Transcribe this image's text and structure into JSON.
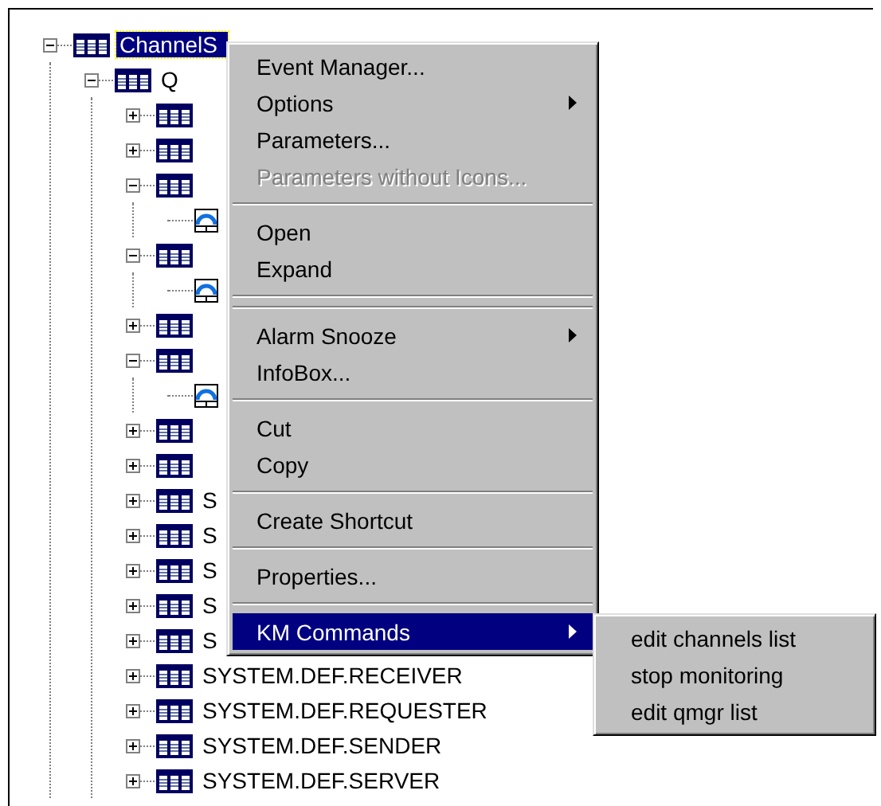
{
  "tree": {
    "kind": "table",
    "label": "ChannelS",
    "selected": true,
    "expanded": true,
    "children": [
      {
        "kind": "table",
        "label": "Q",
        "selected": false,
        "expanded": true,
        "children": [
          {
            "kind": "table",
            "expanded": false
          },
          {
            "kind": "table",
            "expanded": false
          },
          {
            "kind": "table",
            "expanded": true,
            "children": [
              {
                "kind": "monitor"
              }
            ]
          },
          {
            "kind": "table",
            "expanded": true,
            "children": [
              {
                "kind": "monitor"
              }
            ]
          },
          {
            "kind": "table",
            "expanded": false
          },
          {
            "kind": "table",
            "expanded": true,
            "children": [
              {
                "kind": "monitor"
              }
            ]
          },
          {
            "kind": "table",
            "expanded": false
          },
          {
            "kind": "table",
            "expanded": false
          },
          {
            "kind": "table",
            "label": "S",
            "expanded": false
          },
          {
            "kind": "table",
            "label": "S",
            "expanded": false
          },
          {
            "kind": "table",
            "label": "S",
            "expanded": false
          },
          {
            "kind": "table",
            "label": "S",
            "expanded": false
          },
          {
            "kind": "table",
            "label": "S",
            "expanded": false
          },
          {
            "kind": "table",
            "label": "SYSTEM.DEF.RECEIVER",
            "expanded": false
          },
          {
            "kind": "table",
            "label": "SYSTEM.DEF.REQUESTER",
            "expanded": false
          },
          {
            "kind": "table",
            "label": "SYSTEM.DEF.SENDER",
            "expanded": false
          },
          {
            "kind": "table",
            "label": "SYSTEM.DEF.SERVER",
            "expanded": false
          }
        ]
      }
    ]
  },
  "context_menu": {
    "items": [
      {
        "kind": "command",
        "label": "Event Manager...",
        "submenu": false,
        "disabled": false,
        "selected": false
      },
      {
        "kind": "command",
        "label": "Options",
        "submenu": true,
        "disabled": false,
        "selected": false
      },
      {
        "kind": "command",
        "label": "Parameters...",
        "submenu": false,
        "disabled": false,
        "selected": false
      },
      {
        "kind": "command",
        "label": "Parameters without Icons...",
        "submenu": false,
        "disabled": true,
        "selected": false
      },
      {
        "kind": "separator"
      },
      {
        "kind": "command",
        "label": "Open",
        "submenu": false,
        "disabled": false,
        "selected": false
      },
      {
        "kind": "command",
        "label": "Expand",
        "submenu": false,
        "disabled": false,
        "selected": false
      },
      {
        "kind": "separator"
      },
      {
        "kind": "separator"
      },
      {
        "kind": "command",
        "label": "Alarm Snooze",
        "submenu": true,
        "disabled": false,
        "selected": false
      },
      {
        "kind": "command",
        "label": "InfoBox...",
        "submenu": false,
        "disabled": false,
        "selected": false
      },
      {
        "kind": "separator"
      },
      {
        "kind": "command",
        "label": "Cut",
        "submenu": false,
        "disabled": false,
        "selected": false
      },
      {
        "kind": "command",
        "label": "Copy",
        "submenu": false,
        "disabled": false,
        "selected": false
      },
      {
        "kind": "separator"
      },
      {
        "kind": "command",
        "label": "Create Shortcut",
        "submenu": false,
        "disabled": false,
        "selected": false
      },
      {
        "kind": "separator"
      },
      {
        "kind": "command",
        "label": "Properties...",
        "submenu": false,
        "disabled": false,
        "selected": false
      },
      {
        "kind": "separator"
      },
      {
        "kind": "command",
        "label": "KM Commands",
        "submenu": true,
        "disabled": false,
        "selected": true
      }
    ]
  },
  "submenu": {
    "items": [
      {
        "label": "edit channels list"
      },
      {
        "label": "stop monitoring"
      },
      {
        "label": "edit qmgr list"
      }
    ]
  }
}
